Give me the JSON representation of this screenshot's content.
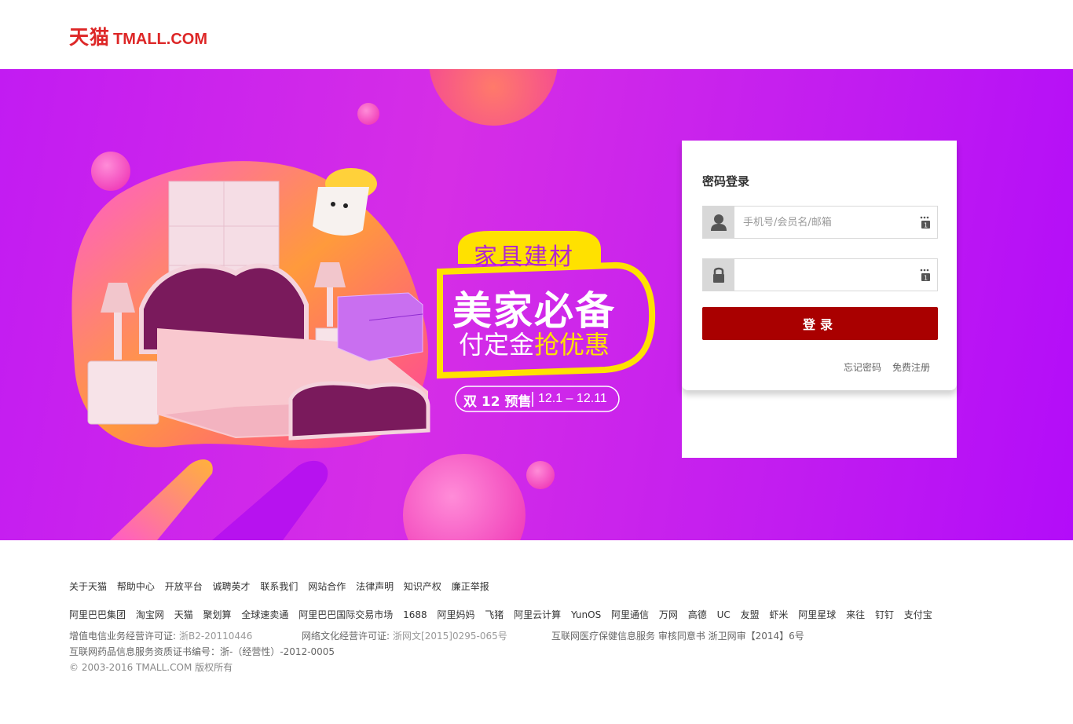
{
  "header": {
    "logo_cn": "天猫",
    "logo_en": "TMALL.COM"
  },
  "banner": {
    "tag": "家具建材",
    "headline": "美家必备",
    "subline_prefix": "付定金",
    "subline_highlight": "抢优惠",
    "promo_label": "双 12 预售",
    "promo_dates": "12.1 – 12.11"
  },
  "login": {
    "title": "密码登录",
    "username_placeholder": "手机号/会员名/邮箱",
    "password_placeholder": "",
    "button_label": "登录",
    "forgot_label": "忘记密码",
    "register_label": "免费注册"
  },
  "footer": {
    "links": [
      "关于天猫",
      "帮助中心",
      "开放平台",
      "诚聘英才",
      "联系我们",
      "网站合作",
      "法律声明",
      "知识产权",
      "廉正举报"
    ],
    "partners": [
      "阿里巴巴集团",
      "淘宝网",
      "天猫",
      "聚划算",
      "全球速卖通",
      "阿里巴巴国际交易市场",
      "1688",
      "阿里妈妈",
      "飞猪",
      "阿里云计算",
      "YunOS",
      "阿里通信",
      "万网",
      "高德",
      "UC",
      "友盟",
      "虾米",
      "阿里星球",
      "来往",
      "钉钉",
      "支付宝"
    ],
    "icp_label": "增值电信业务经营许可证:",
    "icp_value": "浙B2-20110446",
    "culture_label": "网络文化经营许可证:",
    "culture_value": "浙网文[2015]0295-065号",
    "medical": "互联网医疗保健信息服务 审核同意书 浙卫网审【2014】6号",
    "drug": "互联网药品信息服务资质证书编号：浙-（经营性）-2012-0005",
    "copyright": "© 2003-2016 TMALL.COM 版权所有"
  },
  "colors": {
    "brand_red": "#dd2727",
    "login_button": "#a90000",
    "banner_purple": "#c21bf2",
    "banner_yellow": "#ffe100"
  }
}
